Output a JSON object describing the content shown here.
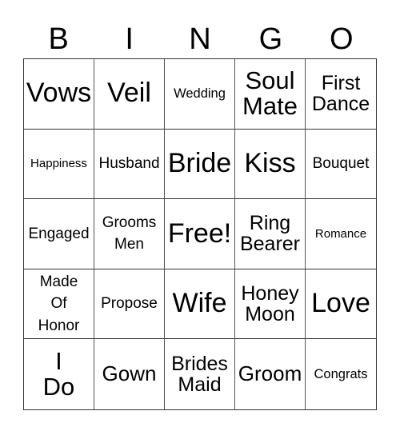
{
  "header": [
    "B",
    "I",
    "N",
    "G",
    "O"
  ],
  "cells": [
    {
      "text": "Vows",
      "size": "s-xl"
    },
    {
      "text": "Veil",
      "size": "s-xl"
    },
    {
      "text": "Wedding",
      "size": "s-xs"
    },
    {
      "text": "Soul\nMate",
      "size": "s-l"
    },
    {
      "text": "First\nDance",
      "size": "s-m"
    },
    {
      "text": "Happiness",
      "size": "s-xxs"
    },
    {
      "text": "Husband",
      "size": "s-s"
    },
    {
      "text": "Bride",
      "size": "s-xl"
    },
    {
      "text": "Kiss",
      "size": "s-xl"
    },
    {
      "text": "Bouquet",
      "size": "s-s"
    },
    {
      "text": "Engaged",
      "size": "s-s"
    },
    {
      "text": "Grooms\nMen",
      "size": "s-s"
    },
    {
      "text": "Free!",
      "size": "s-xl"
    },
    {
      "text": "Ring\nBearer",
      "size": "s-m"
    },
    {
      "text": "Romance",
      "size": "s-xxs"
    },
    {
      "text": "Made\nOf\nHonor",
      "size": "s-s"
    },
    {
      "text": "Propose",
      "size": "s-s"
    },
    {
      "text": "Wife",
      "size": "s-xl"
    },
    {
      "text": "Honey\nMoon",
      "size": "s-m"
    },
    {
      "text": "Love",
      "size": "s-xl"
    },
    {
      "text": "I\nDo",
      "size": "s-l"
    },
    {
      "text": "Gown",
      "size": "s-m2"
    },
    {
      "text": "Brides\nMaid",
      "size": "s-m"
    },
    {
      "text": "Groom",
      "size": "s-m2"
    },
    {
      "text": "Congrats",
      "size": "s-xs"
    }
  ]
}
